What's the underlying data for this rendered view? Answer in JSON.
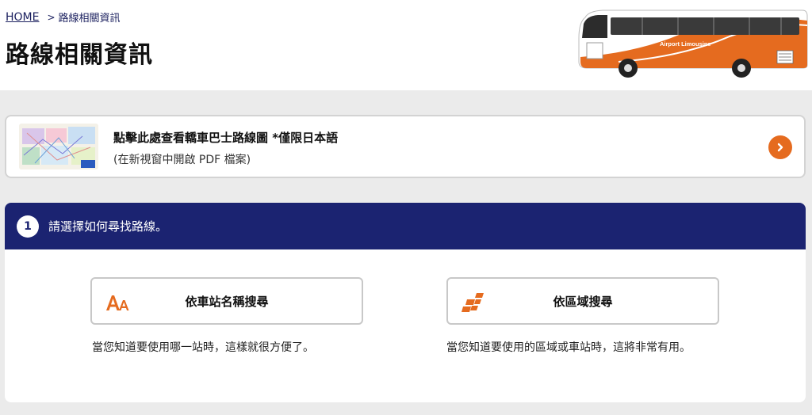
{
  "breadcrumb": {
    "home": "HOME",
    "separator": ">",
    "current": "路線相關資訊"
  },
  "page": {
    "title": "路線相關資訊"
  },
  "bus": {
    "brand": "Airport Limousine"
  },
  "pdf_link": {
    "title": "點擊此處查看轎車巴士路線圖 *僅限日本語",
    "subtitle": "(在新視窗中開啟 PDF 檔案)",
    "arrow_icon": "chevron-right-icon"
  },
  "step": {
    "number": "1",
    "title": "請選擇如何尋找路線。",
    "options": [
      {
        "label": "依車站名稱搜尋",
        "icon": "font-size-icon",
        "description": "當您知道要使用哪一站時，這樣就很方便了。"
      },
      {
        "label": "依區域搜尋",
        "icon": "area-map-icon",
        "description": "當您知道要使用的區域或車站時，這將非常有用。"
      }
    ]
  },
  "colors": {
    "accent": "#e56b1f",
    "navy": "#1b2371",
    "background": "#ebebeb"
  }
}
